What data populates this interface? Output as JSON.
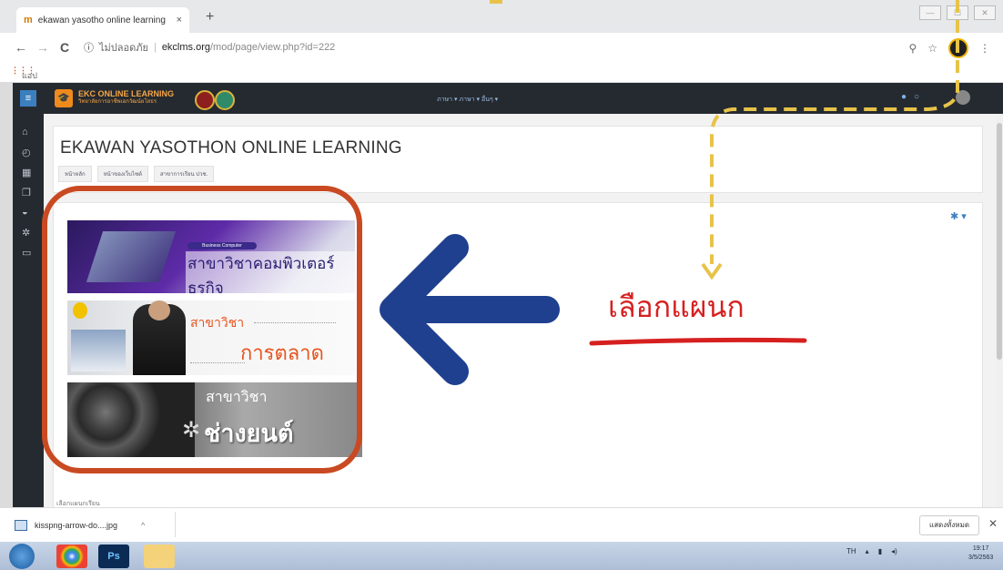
{
  "browser": {
    "tab_title": "ekawan yasotho online learning",
    "tab_favicon": "moodle-favicon",
    "new_tab": "+",
    "back": "←",
    "forward": "→",
    "reload": "C",
    "security_label": "ไม่ปลอดภัย",
    "url_host": "ekclms.org",
    "url_path": "/mod/page/view.php?id=222",
    "bookmarks_label": "แอป",
    "window_controls": [
      "—",
      "☐",
      "✕"
    ]
  },
  "moodle": {
    "logo_title": "EKC ONLINE LEARNING",
    "logo_subtitle": "วิทยาลัยการอาชีพเอกวัฒน์ยโสธร",
    "top_menu": "ภาษา ▾   ภาษา ▾   อื่นๆ ▾",
    "page_title": "EKAWAN YASOTHON ONLINE LEARNING",
    "breadcrumb": [
      "หน้าหลัก",
      "หน้าของเว็บไซต์",
      "สาขาการเรียน ปวช."
    ],
    "footer_text": "เลือกแผนกเรียน",
    "sidebar_icons": [
      "home-icon",
      "dashboard-icon",
      "calendar-icon",
      "files-icon",
      "badge-icon",
      "gear-icon",
      "folder-icon"
    ]
  },
  "departments": [
    {
      "pill": "Business Computer",
      "title": "สาขาวิชาคอมพิวเตอร์ธุรกิจ"
    },
    {
      "line1": "สาขาวิชา",
      "line2": "การตลาด"
    },
    {
      "line1": "สาขาวิชา",
      "line2": "ช่างยนต์"
    }
  ],
  "annotation": {
    "select_department": "เลือกแผนก",
    "accent_red": "#c94a22",
    "arrow_blue": "#1f3f8f",
    "guide_yellow": "#e7c34a"
  },
  "downloads": {
    "filename": "kisspng-arrow-do....jpg",
    "show_all": "แสดงทั้งหมด",
    "close": "✕"
  },
  "taskbar": {
    "ps_label": "Ps",
    "language": "TH",
    "time": "19:17",
    "date": "3/5/2563"
  }
}
